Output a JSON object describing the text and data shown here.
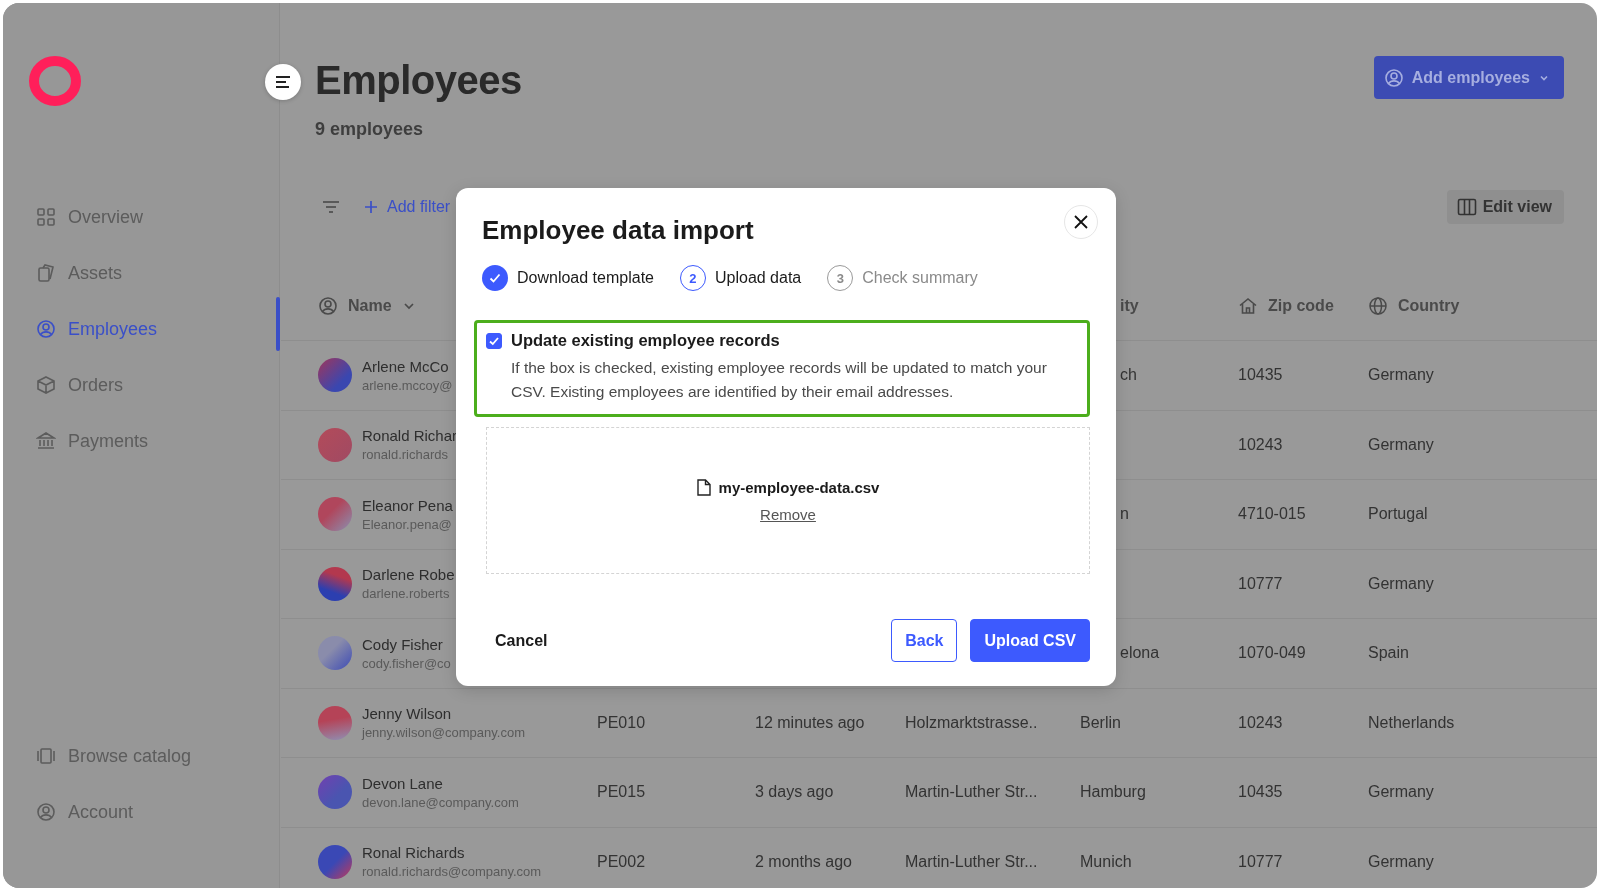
{
  "sidebar": {
    "items": [
      {
        "label": "Overview",
        "selected": false
      },
      {
        "label": "Assets",
        "selected": false
      },
      {
        "label": "Employees",
        "selected": true
      },
      {
        "label": "Orders",
        "selected": false
      },
      {
        "label": "Payments",
        "selected": false
      }
    ],
    "bottom_items": [
      {
        "label": "Browse catalog",
        "selected": false
      },
      {
        "label": "Account",
        "selected": false
      }
    ]
  },
  "header": {
    "title": "Employees",
    "count": "9 employees",
    "add_button": "Add employees"
  },
  "toolbar": {
    "add_filter": "Add filter",
    "edit_view": "Edit view"
  },
  "table": {
    "header": {
      "name": "Name",
      "city": "ity",
      "zip": "Zip code",
      "country": "Country"
    },
    "rows": [
      {
        "name": "Arlene McCo",
        "email": "arlene.mccoy@",
        "city": "ch",
        "zip": "10435",
        "country": "Germany"
      },
      {
        "name": "Ronald Richar",
        "email": "ronald.richards",
        "zip": "10243",
        "country": "Germany"
      },
      {
        "name": "Eleanor Pena",
        "email": "Eleanor.pena@",
        "city": "n",
        "zip": "4710-015",
        "country": "Portugal"
      },
      {
        "name": "Darlene Robe",
        "email": "darlene.roberts",
        "zip": "10777",
        "country": "Germany"
      },
      {
        "name": "Cody Fisher",
        "email": "cody.fisher@co",
        "city": "elona",
        "zip": "1070-049",
        "country": "Spain"
      },
      {
        "name": "Jenny Wilson",
        "email": "jenny.wilson@company.com",
        "id": "PE010",
        "last_active": "12 minutes ago",
        "address": "Holzmarktstrasse..",
        "city": "Berlin",
        "zip": "10243",
        "country": "Netherlands"
      },
      {
        "name": "Devon Lane",
        "email": "devon.lane@company.com",
        "id": "PE015",
        "last_active": "3 days ago",
        "address": "Martin-Luther Str...",
        "city": "Hamburg",
        "zip": "10435",
        "country": "Germany"
      },
      {
        "name": "Ronal Richards",
        "email": "ronald.richards@company.com",
        "id": "PE002",
        "last_active": "2 months ago",
        "address": "Martin-Luther Str...",
        "city": "Munich",
        "zip": "10777",
        "country": "Germany"
      }
    ]
  },
  "dialog": {
    "title": "Employee data import",
    "steps": [
      {
        "label": "Download template",
        "completed": true,
        "selected": false
      },
      {
        "number": "2",
        "label": "Upload data",
        "completed": false,
        "selected": true
      },
      {
        "number": "3",
        "label": "Check summary",
        "completed": false,
        "selected": false
      }
    ],
    "update_option": {
      "label": "Update existing employee records",
      "checked": true,
      "highlighted": true,
      "description": "If the box is checked, existing employee records will be updated to match your CSV. Existing employees are identified by their email addresses."
    },
    "file": {
      "name": "my-employee-data.csv",
      "remove": "Remove"
    },
    "cancel": "Cancel",
    "back": "Back",
    "submit": "Upload CSV"
  }
}
